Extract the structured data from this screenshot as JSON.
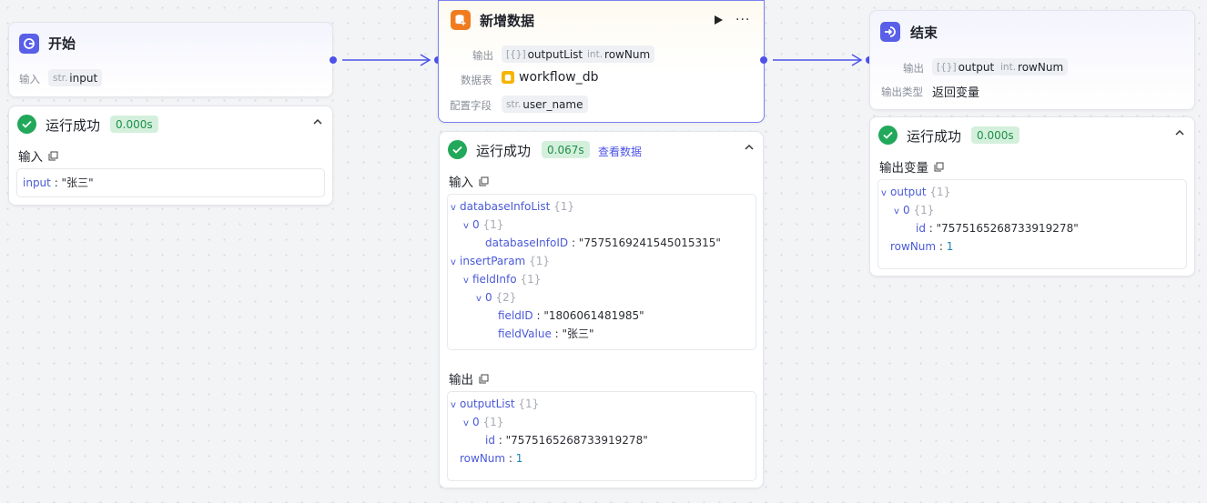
{
  "start": {
    "title": "开始",
    "input_label": "输入",
    "input_type": "str.",
    "input_name": "input",
    "result": {
      "status": "运行成功",
      "time": "0.000s",
      "input_header": "输入",
      "line_key": "input",
      "line_value": "\"张三\""
    }
  },
  "insert": {
    "title": "新增数据",
    "output_label": "输出",
    "out1_type": "[{}]",
    "out1_name": "outputList",
    "out2_type": "int.",
    "out2_name": "rowNum",
    "table_label": "数据表",
    "table_name": "workflow_db",
    "field_label": "配置字段",
    "field_type": "str.",
    "field_name": "user_name",
    "result": {
      "status": "运行成功",
      "time": "0.067s",
      "view_link": "查看数据",
      "input_header": "输入",
      "output_header": "输出",
      "in_tree": {
        "l1k": "databaseInfoList",
        "l1c": "{1}",
        "l2k": "0",
        "l2c": "{1}",
        "l3k": "databaseInfoID",
        "l3v": "\"7575169241545015315\"",
        "l4k": "insertParam",
        "l4c": "{1}",
        "l5k": "fieldInfo",
        "l5c": "{1}",
        "l6k": "0",
        "l6c": "{2}",
        "l7k": "fieldID",
        "l7v": "\"1806061481985\"",
        "l8k": "fieldValue",
        "l8v": "\"张三\""
      },
      "out_tree": {
        "l1k": "outputList",
        "l1c": "{1}",
        "l2k": "0",
        "l2c": "{1}",
        "l3k": "id",
        "l3v": "\"7575165268733919278\"",
        "l4k": "rowNum",
        "l4v": "1"
      }
    }
  },
  "end": {
    "title": "结束",
    "output_label": "输出",
    "out1_type": "[{}]",
    "out1_name": "output",
    "out2_type": "int.",
    "out2_name": "rowNum",
    "type_label": "输出类型",
    "type_value": "返回变量",
    "result": {
      "status": "运行成功",
      "time": "0.000s",
      "header": "输出变量",
      "tree": {
        "l1k": "output",
        "l1c": "{1}",
        "l2k": "0",
        "l2c": "{1}",
        "l3k": "id",
        "l3v": "\"7575165268733919278\"",
        "l4k": "rowNum",
        "l4v": "1"
      }
    }
  },
  "colors": {
    "accent": "#4d53e8",
    "success": "#22a85a",
    "success_badge_bg": "#d4f0dc",
    "db_icon": "#f07c1f"
  }
}
